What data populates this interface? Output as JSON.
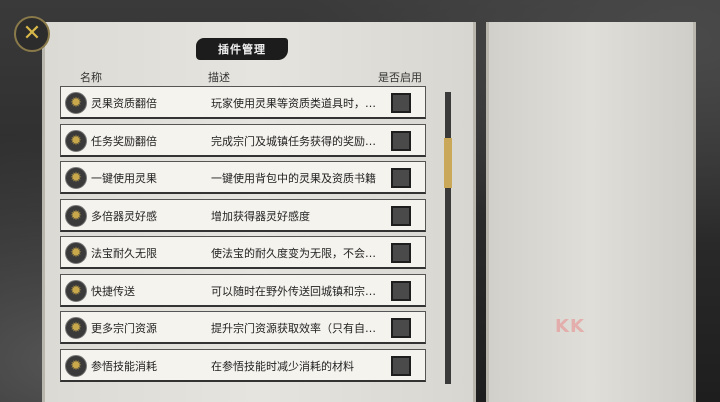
{
  "title": "插件管理",
  "headers": {
    "name": "名称",
    "desc": "描述",
    "enable": "是否启用"
  },
  "icons": {
    "close": "close-x-icon",
    "row_icon": "gear-icon"
  },
  "colors": {
    "accent_gold": "#d9b84a",
    "panel": "#e4e2dc",
    "title_bg": "#1c1c1c"
  },
  "plugins": [
    {
      "name": "灵果资质翻倍",
      "desc": "玩家使用灵果等资质类道具时，…",
      "enabled": false
    },
    {
      "name": "任务奖励翻倍",
      "desc": "完成宗门及城镇任务获得的奖励…",
      "enabled": false
    },
    {
      "name": "一键使用灵果",
      "desc": "一键使用背包中的灵果及资质书籍",
      "enabled": false
    },
    {
      "name": "多倍器灵好感",
      "desc": "增加获得器灵好感度",
      "enabled": false
    },
    {
      "name": "法宝耐久无限",
      "desc": "使法宝的耐久度变为无限，不会…",
      "enabled": false
    },
    {
      "name": "快捷传送",
      "desc": "可以随时在野外传送回城镇和宗…",
      "enabled": false
    },
    {
      "name": "更多宗门资源",
      "desc": "提升宗门资源获取效率（只有自…",
      "enabled": false
    },
    {
      "name": "参悟技能消耗",
      "desc": "在参悟技能时减少消耗的材料",
      "enabled": false
    }
  ],
  "watermark": "KK"
}
